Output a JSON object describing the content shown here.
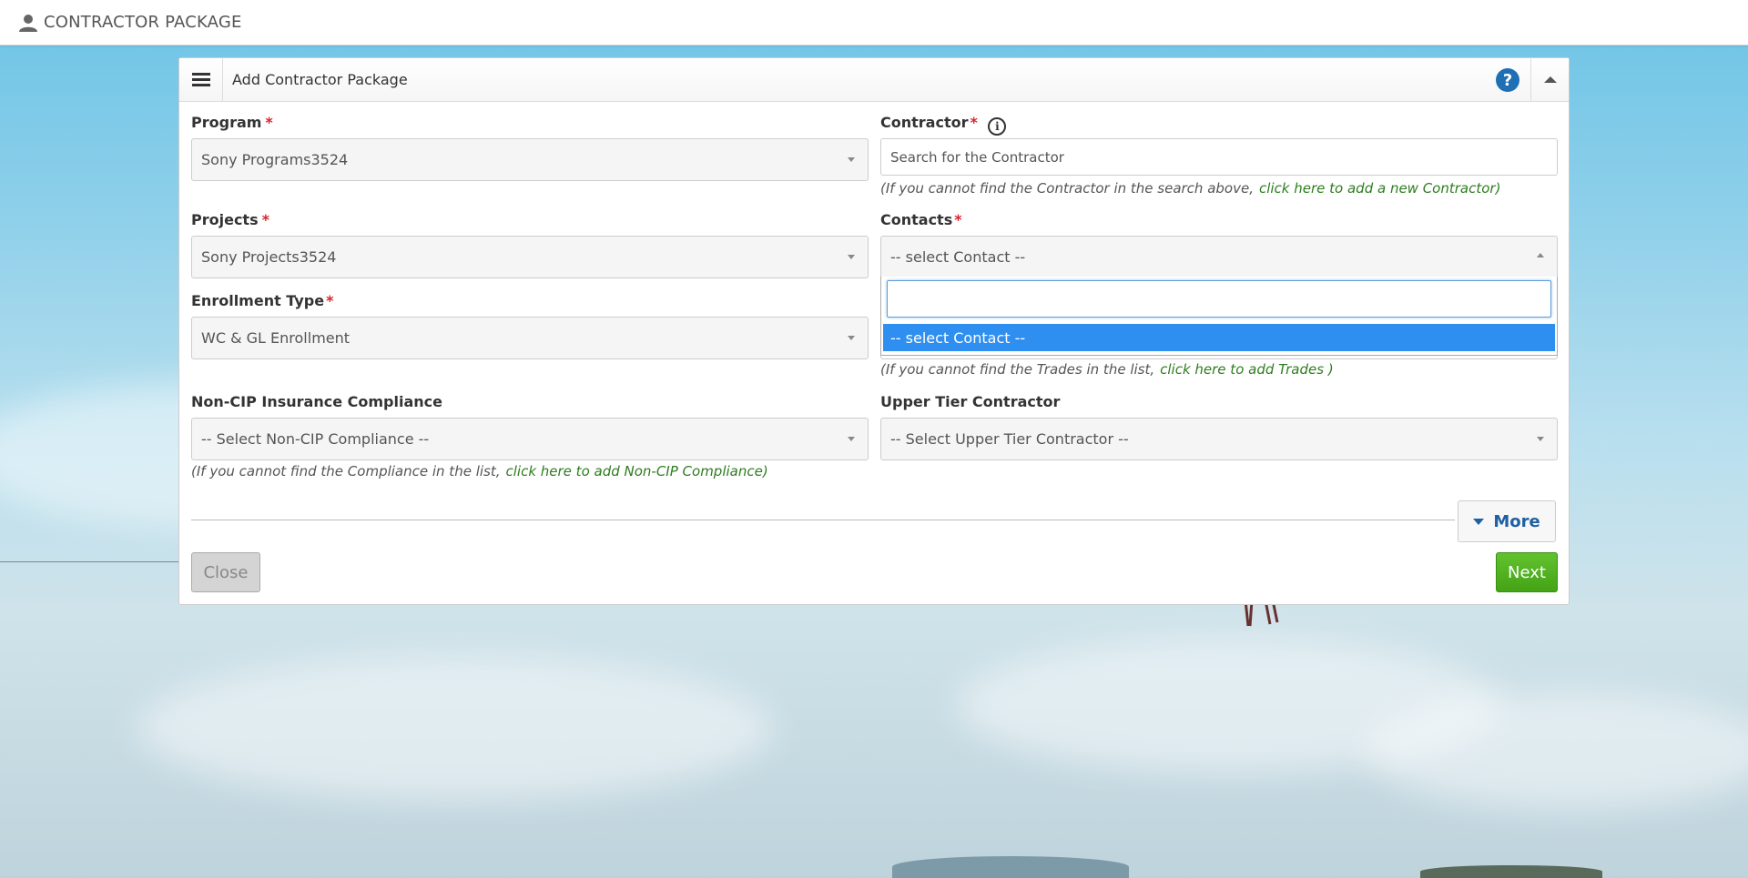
{
  "topbar": {
    "title": "CONTRACTOR PACKAGE"
  },
  "panel": {
    "title": "Add Contractor Package",
    "help": "?"
  },
  "form": {
    "program": {
      "label": "Program",
      "required": "*",
      "value": "Sony Programs3524"
    },
    "contractor": {
      "label": "Contractor",
      "required": "*",
      "info": "i",
      "placeholder": "Search for the Contractor",
      "hint": "(If you cannot find the Contractor in the search above,",
      "hint_link": "click here to add a new Contractor)"
    },
    "projects": {
      "label": "Projects",
      "required": "*",
      "value": "Sony Projects3524"
    },
    "contacts": {
      "label": "Contacts",
      "required": "*",
      "value": "-- select Contact --",
      "option_selected": "-- select Contact --"
    },
    "enrollment": {
      "label": "Enrollment Type",
      "required": "*",
      "value": "WC & GL Enrollment"
    },
    "trades_hint": {
      "text": "(If you cannot find the Trades in the list,",
      "link": "click here to add Trades )"
    },
    "noncip": {
      "label": "Non-CIP Insurance Compliance",
      "value": "-- Select Non-CIP Compliance --",
      "hint": "(If you cannot find the Compliance in the list,",
      "hint_link": "click here to add Non-CIP Compliance)"
    },
    "upper_tier": {
      "label": "Upper Tier Contractor",
      "value": "-- Select Upper Tier Contractor --"
    }
  },
  "buttons": {
    "more": "More",
    "close": "Close",
    "next": "Next"
  }
}
